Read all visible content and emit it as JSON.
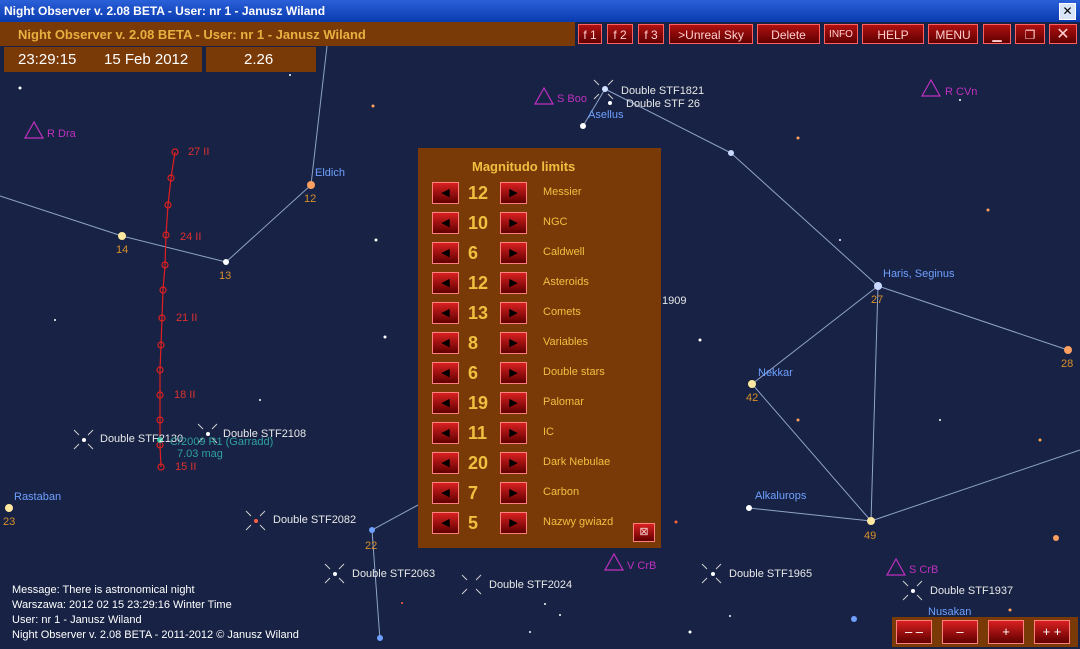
{
  "window": {
    "title": "Night Observer v. 2.08 BETA -  User:  nr 1 - Janusz Wiland",
    "close_glyph": "✕"
  },
  "header": {
    "title": "Night Observer v. 2.08 BETA -  User:  nr 1 - Janusz Wiland",
    "time": "23:29:15",
    "date": "15 Feb 2012",
    "zoom": "2.26"
  },
  "toolbar": {
    "f1": "f 1",
    "f2": "f 2",
    "f3": "f 3",
    "unreal_sky": ">Unreal Sky",
    "delete": "Delete",
    "info": "INFO",
    "help": "HELP",
    "menu": "MENU"
  },
  "panel": {
    "title": "Magnitudo limits",
    "rows": [
      {
        "value": "12",
        "label": "Messier"
      },
      {
        "value": "10",
        "label": "NGC"
      },
      {
        "value": "6",
        "label": "Caldwell"
      },
      {
        "value": "12",
        "label": "Asteroids"
      },
      {
        "value": "13",
        "label": "Comets"
      },
      {
        "value": "8",
        "label": "Variables"
      },
      {
        "value": "6",
        "label": "Double stars"
      },
      {
        "value": "19",
        "label": "Palomar"
      },
      {
        "value": "11",
        "label": "IC"
      },
      {
        "value": "20",
        "label": "Dark Nebulae"
      },
      {
        "value": "7",
        "label": "Carbon"
      },
      {
        "value": "5",
        "label": "Nazwy gwiazd"
      }
    ]
  },
  "status": {
    "message": "Message: There is astronomical night",
    "location": "Warszawa:  2012 02 15  23:29:16 Winter Time",
    "user": "User:  nr 1 - Janusz Wiland",
    "copyright": "Night Observer v. 2.08 BETA - 2011-2012 © Janusz Wiland"
  },
  "zoom_buttons": {
    "zoom_out_more": "– –",
    "zoom_out": "–",
    "zoom_in": "+",
    "zoom_in_more": "+ +"
  },
  "sky": {
    "labels": {
      "r_dra": "R Dra",
      "s_boo": "S Boo",
      "r_cvn": "R CVn",
      "dbl_stf1821": "Double STF1821",
      "dbl_stf26": "Double STF  26",
      "asellus": "Asellus",
      "eldich": "Eldich",
      "haris": "Haris, Seginus",
      "nekkar": "Nekkar",
      "alkalurops": "Alkalurops",
      "rastaban": "Rastaban",
      "dbl_stf2130": "Double STF2130",
      "dbl_stf2108": "Double STF2108",
      "comet": "C/2009 R1 (Garradd)",
      "comet_mag": "7.03 mag",
      "dbl_stf2082": "Double STF2082",
      "dbl_stf2063": "Double STF2063",
      "dbl_stf2024": "Double STF2024",
      "v_crb": "V CrB",
      "dbl_stf1965": "Double STF1965",
      "s_crb": "S CrB",
      "dbl_stf1937": "Double STF1937",
      "nusakan": "Nusakan",
      "n1909": "1909",
      "m14": "14",
      "m13": "13",
      "m12": "12",
      "m27": "27",
      "m42": "42",
      "m49": "49",
      "m23": "23",
      "m22": "22",
      "m28": "28",
      "d27": "27 II",
      "d24": "24 II",
      "d21": "21 II",
      "d18": "18 II",
      "d15": "15 II"
    }
  }
}
